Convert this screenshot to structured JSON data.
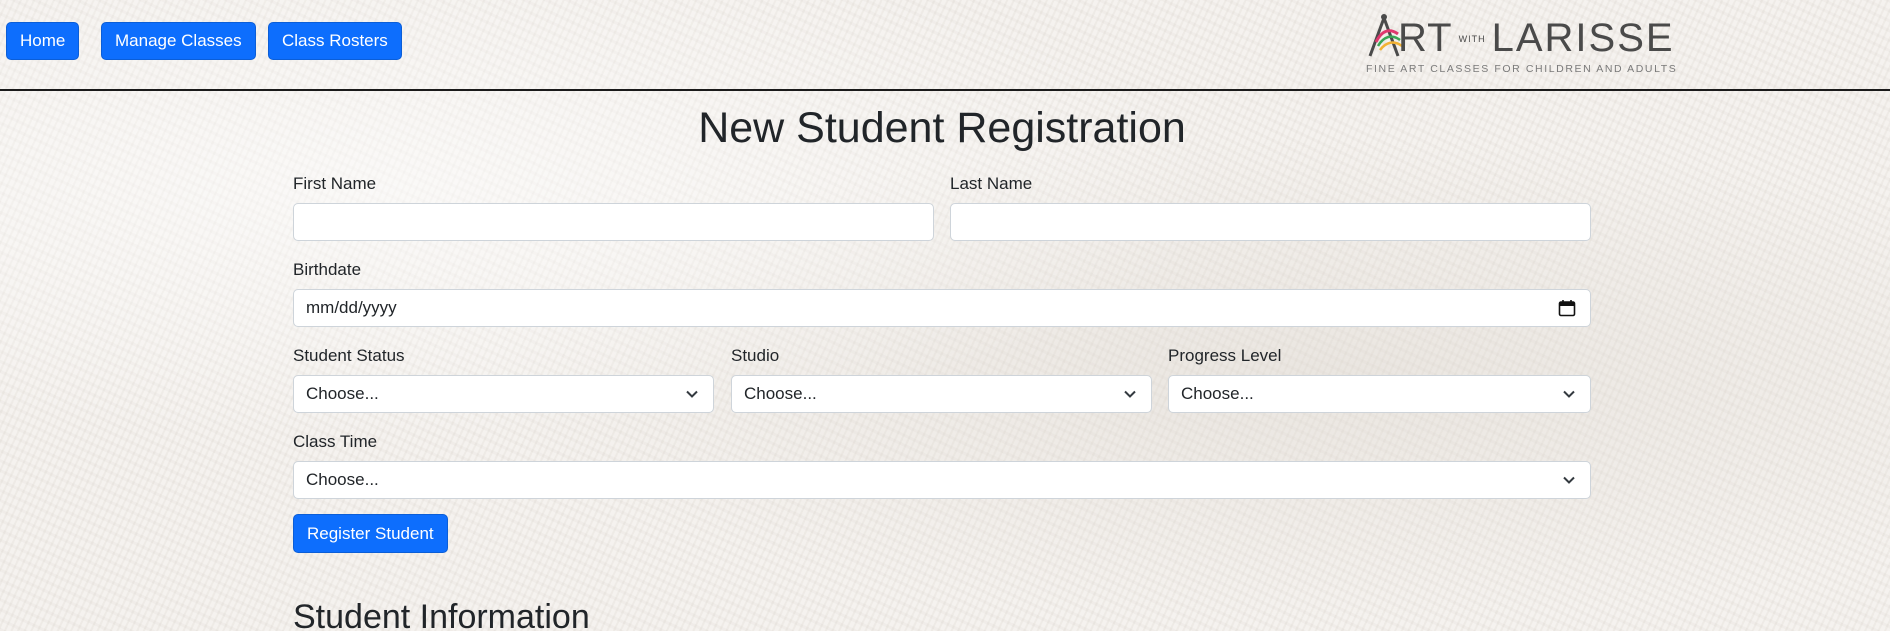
{
  "nav": {
    "home_label": "Home",
    "manage_classes_label": "Manage Classes",
    "class_rosters_label": "Class Rosters"
  },
  "logo": {
    "art": "RT",
    "with": "WITH",
    "name": "LARISSE",
    "tagline": "FINE ART CLASSES FOR CHILDREN AND ADULTS"
  },
  "page_title": "New Student Registration",
  "form": {
    "first_name": {
      "label": "First Name",
      "value": ""
    },
    "last_name": {
      "label": "Last Name",
      "value": ""
    },
    "birthdate": {
      "label": "Birthdate",
      "placeholder": "mm/dd/yyyy"
    },
    "student_status": {
      "label": "Student Status",
      "selected": "Choose..."
    },
    "studio": {
      "label": "Studio",
      "selected": "Choose..."
    },
    "progress_level": {
      "label": "Progress Level",
      "selected": "Choose..."
    },
    "class_time": {
      "label": "Class Time",
      "selected": "Choose..."
    },
    "submit_label": "Register Student"
  },
  "section_title": "Student Information",
  "colors": {
    "primary": "#0d6efd",
    "text": "#212529",
    "background": "#f3f0ec"
  },
  "icons": {
    "date": "calendar-icon",
    "dropdown": "chevron-down-icon"
  }
}
